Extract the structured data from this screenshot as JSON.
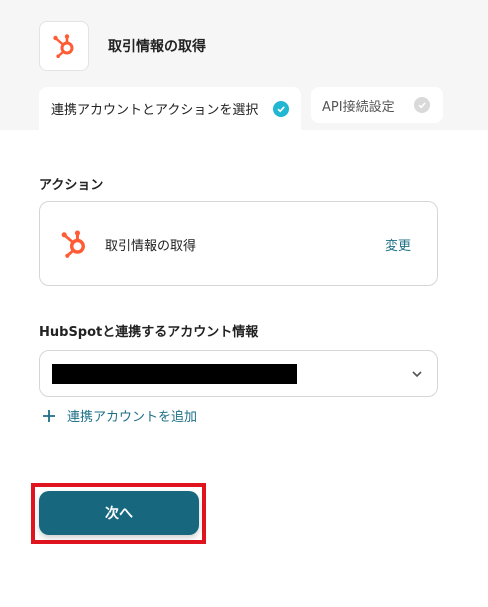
{
  "header": {
    "title": "取引情報の取得",
    "app_icon": "hubspot-icon"
  },
  "tabs": [
    {
      "label": "連携アカウントとアクションを選択",
      "status": "complete",
      "active": true
    },
    {
      "label": "API接続設定",
      "status": "pending",
      "active": false
    }
  ],
  "action_section": {
    "label": "アクション",
    "action_name": "取引情報の取得",
    "change_label": "変更",
    "icon": "hubspot-icon"
  },
  "account_section": {
    "label": "HubSpotと連携するアカウント情報",
    "selected_value_redacted": true,
    "add_account_label": "連携アカウントを追加"
  },
  "footer": {
    "next_label": "次へ"
  },
  "colors": {
    "brand_hubspot": "#ff5c35",
    "accent_teal": "#17687f",
    "link": "#1d6f86",
    "check_active": "#21b6d1",
    "highlight_frame": "#e0141e"
  }
}
